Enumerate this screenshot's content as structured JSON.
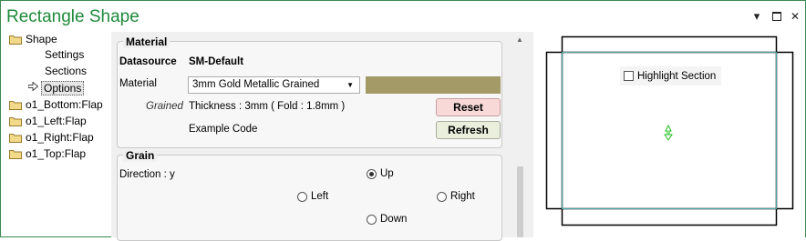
{
  "window": {
    "title": "Rectangle Shape",
    "colors": {
      "title": "#1f8a3b",
      "border": "#3a8a4f"
    }
  },
  "titlebar_buttons": {
    "dropdown_glyph": "▾",
    "maximize_glyph": "□",
    "close_glyph": "✕"
  },
  "tree": {
    "items": [
      {
        "label": "Shape",
        "icon": "folder-icon"
      },
      {
        "label": "Settings"
      },
      {
        "label": "Sections"
      },
      {
        "label": "Options",
        "icon": "arrow-right-icon",
        "selected": true
      },
      {
        "label": "o1_Bottom:Flap",
        "icon": "folder-icon"
      },
      {
        "label": "o1_Left:Flap",
        "icon": "folder-icon"
      },
      {
        "label": "o1_Right:Flap",
        "icon": "folder-icon"
      },
      {
        "label": "o1_Top:Flap",
        "icon": "folder-icon"
      }
    ]
  },
  "material": {
    "group_title": "Material",
    "datasource_label": "Datasource",
    "datasource_value": "SM-Default",
    "material_label": "Material",
    "material_value": "3mm Gold Metallic Grained",
    "swatch_color": "#a39a68",
    "grained_label": "Grained",
    "thickness_text": "Thickness : 3mm ( Fold : 1.8mm )",
    "reset_label": "Reset",
    "example_code_label": "Example Code",
    "refresh_label": "Refresh"
  },
  "grain": {
    "group_title": "Grain",
    "direction_label": "Direction : y",
    "options": {
      "up": {
        "label": "Up",
        "checked": true
      },
      "left": {
        "label": "Left",
        "checked": false
      },
      "right": {
        "label": "Right",
        "checked": false
      },
      "down": {
        "label": "Down",
        "checked": false
      }
    }
  },
  "preview": {
    "highlight_section_label": "Highlight Section",
    "highlight_section_checked": false
  }
}
